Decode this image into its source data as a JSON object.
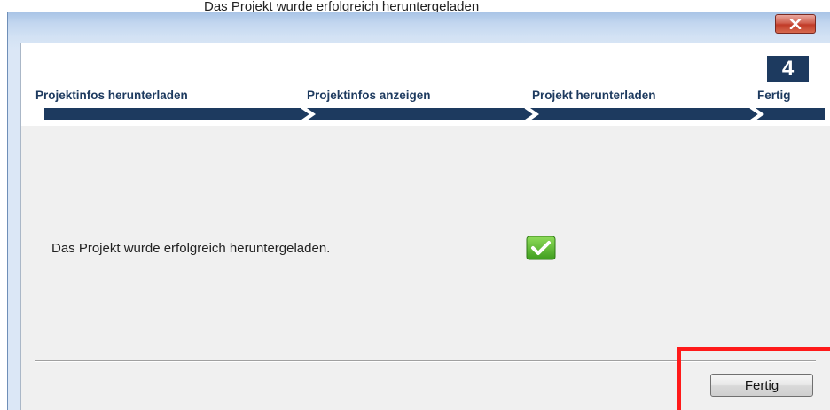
{
  "caption": "Das Projekt wurde erfolgreich heruntergeladen",
  "window": {
    "close_label": ""
  },
  "wizard": {
    "current_step_number": "4",
    "steps": [
      {
        "label": "Projektinfos herunterladen"
      },
      {
        "label": "Projektinfos anzeigen"
      },
      {
        "label": "Projekt herunterladen"
      },
      {
        "label": "Fertig"
      }
    ],
    "accent_color": "#1d3a5f"
  },
  "content": {
    "status_message": "Das Projekt wurde erfolgreich heruntergeladen.",
    "status_icon": "checkmark-success-icon",
    "success_color": "#5cb82e"
  },
  "footer": {
    "finish_button_label": "Fertig"
  },
  "annotation": {
    "highlight_color": "#ff1a1a"
  }
}
